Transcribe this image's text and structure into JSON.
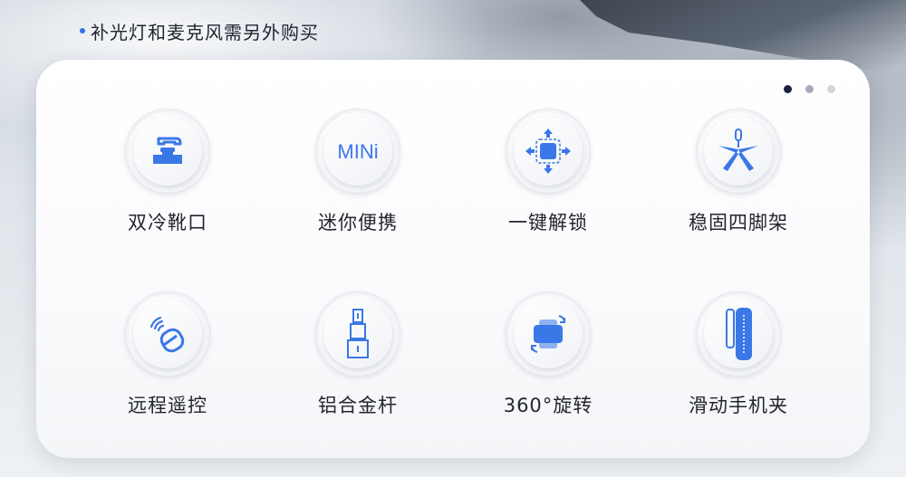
{
  "note": {
    "text": "补光灯和麦克风需另外购买"
  },
  "pager": {
    "count": 3,
    "active_index": 0
  },
  "features": [
    {
      "label": "双冷靴口",
      "icon": "dual-cold-shoe-icon"
    },
    {
      "label": "迷你便携",
      "icon": "mini-icon",
      "icon_text": "MINi"
    },
    {
      "label": "一键解锁",
      "icon": "one-key-unlock-icon"
    },
    {
      "label": "稳固四脚架",
      "icon": "tripod-icon"
    },
    {
      "label": "远程遥控",
      "icon": "remote-control-icon"
    },
    {
      "label": "铝合金杆",
      "icon": "aluminum-pole-icon"
    },
    {
      "label": "360°旋转",
      "icon": "rotate-360-icon"
    },
    {
      "label": "滑动手机夹",
      "icon": "phone-clamp-icon"
    }
  ],
  "colors": {
    "accent": "#2f73e8",
    "icon_blue": "#3b78e7",
    "text": "#23262d"
  }
}
